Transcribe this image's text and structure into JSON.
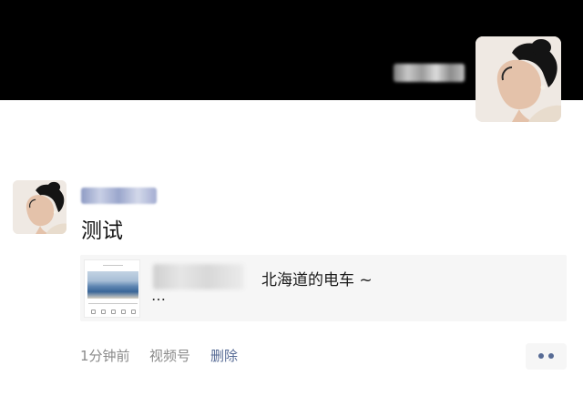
{
  "header": {
    "avatar_icon": "user-avatar-icon"
  },
  "post": {
    "avatar_icon": "user-avatar-icon",
    "text": "测试",
    "share_card": {
      "thumb_icon": "music-video-thumbnail-icon",
      "title": "北海道的电车 ~",
      "more": "…"
    },
    "meta": {
      "time": "1分钟前",
      "source": "视频号",
      "delete": "删除"
    },
    "more_button_icon": "more-dots-icon"
  },
  "colors": {
    "link": "#576b95",
    "cover": "#000000",
    "card_bg": "#f6f6f6"
  }
}
